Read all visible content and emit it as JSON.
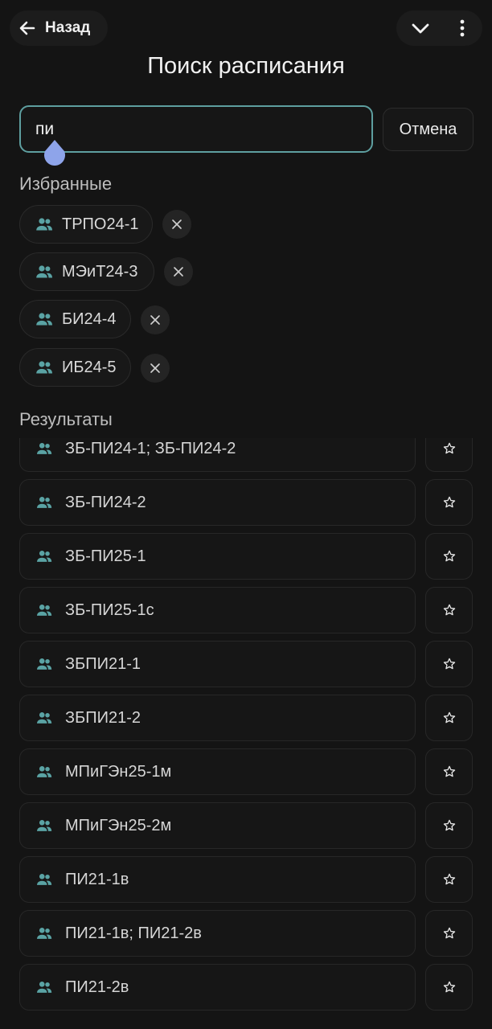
{
  "header": {
    "back_label": "Назад",
    "title": "Поиск расписания",
    "icons": [
      "arrow-left-icon",
      "chevron-down-icon",
      "more-vertical-icon"
    ]
  },
  "search": {
    "value": "пи",
    "cancel_label": "Отмена"
  },
  "favorites": {
    "label": "Избранные",
    "items": [
      {
        "label": "ТРПО24-1"
      },
      {
        "label": "МЭиТ24-3"
      },
      {
        "label": "БИ24-4"
      },
      {
        "label": "ИБ24-5"
      }
    ]
  },
  "results": {
    "label": "Результаты",
    "items": [
      {
        "label": "ЗБ-ПИ24-1; ЗБ-ПИ24-2"
      },
      {
        "label": "ЗБ-ПИ24-2"
      },
      {
        "label": "ЗБ-ПИ25-1"
      },
      {
        "label": "ЗБ-ПИ25-1с"
      },
      {
        "label": "ЗБПИ21-1"
      },
      {
        "label": "ЗБПИ21-2"
      },
      {
        "label": "МПиГЭн25-1м"
      },
      {
        "label": "МПиГЭн25-2м"
      },
      {
        "label": "ПИ21-1в"
      },
      {
        "label": "ПИ21-1в; ПИ21-2в"
      },
      {
        "label": "ПИ21-2в"
      }
    ]
  },
  "colors": {
    "accent": "#5e9fa0",
    "group_icon": "#5aa3a4",
    "caret_handle": "#8ea4ea",
    "background": "#141414"
  }
}
